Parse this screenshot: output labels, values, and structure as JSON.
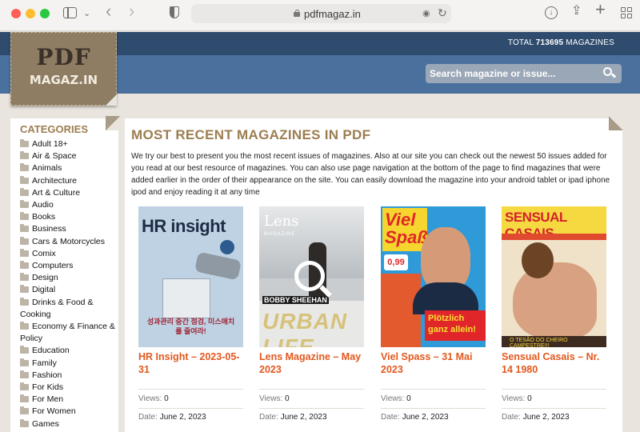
{
  "browser": {
    "url": "pdfmagaz.in"
  },
  "header": {
    "total_label": "TOTAL",
    "total_count": "713695",
    "total_suffix": "MAGAZINES",
    "search_placeholder": "Search magazine or issue...",
    "logo_line1": "PDF",
    "logo_line2": "MAGAZ.IN"
  },
  "sidebar": {
    "title": "CATEGORIES",
    "items": [
      "Adult 18+",
      "Air & Space",
      "Animals",
      "Architecture",
      "Art & Culture",
      "Audio",
      "Books",
      "Business",
      "Cars & Motorcycles",
      "Comix",
      "Computers",
      "Design",
      "Digital",
      "Drinks & Food & Cooking",
      "Economy & Finance & Policy",
      "Education",
      "Family",
      "Fashion",
      "For Kids",
      "For Men",
      "For Women",
      "Games"
    ]
  },
  "main": {
    "title": "MOST RECENT MAGAZINES IN PDF",
    "description": "We try our best to present you the most recent issues of magazines. Also at our site you can check out the newest 50 issues added for you read at our best resource of magazines. You can also use page navigation at the bottom of the page to find magazines that were added earlier in the order of their appearance on the site. You can easily download the magazine into your android tablet or ipad iphone ipod and enjoy reading it at any time",
    "views_label": "Views:",
    "date_label": "Date:",
    "cards": [
      {
        "title": "HR Insight – 2023-05-31",
        "views": "0",
        "date": "June 2, 2023",
        "cover_text": "HR insight",
        "cover_caption": "성과관리 중간 점검, 미스매치를 줄여라!"
      },
      {
        "title": "Lens Magazine – May 2023",
        "views": "0",
        "date": "June 2, 2023",
        "cover_text": "Lens",
        "cover_caption": "URBAN LIFE",
        "cover_sub": "BOBBY SHEEHAN",
        "cover_mag": "MAGAZINE"
      },
      {
        "title": "Viel Spass – 31 Mai 2023",
        "views": "0",
        "date": "June 2, 2023",
        "cover_text": "Viel Spaß",
        "cover_price": "0,99",
        "cover_caption": "Plötzlich ganz allein!"
      },
      {
        "title": "Sensual Casais – Nr. 14 1980",
        "views": "0",
        "date": "June 2, 2023",
        "cover_text": "SENSUAL CASAIS",
        "cover_caption": "O TESÃO DO CHEIRO CAMPESTRE!!!"
      }
    ]
  }
}
